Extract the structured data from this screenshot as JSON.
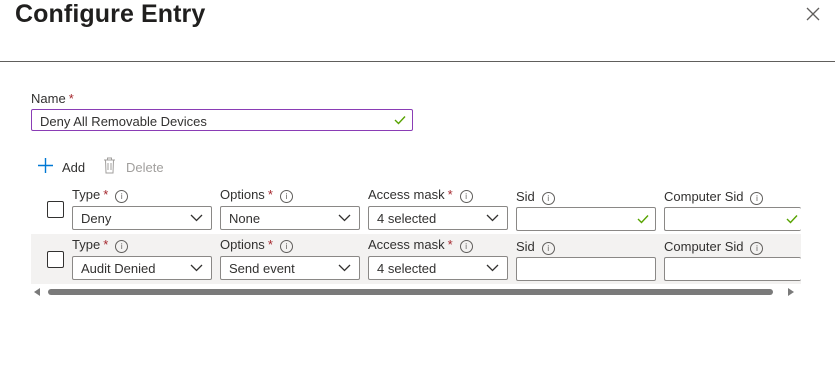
{
  "panel": {
    "title": "Configure Entry",
    "close_icon": "close-icon"
  },
  "name_field": {
    "label": "Name",
    "required_mark": "*",
    "value": "Deny All Removable Devices",
    "valid": true
  },
  "toolbar": {
    "add_label": "Add",
    "delete_label": "Delete",
    "add_icon": "plus-icon",
    "delete_icon": "trash-icon"
  },
  "columns": {
    "type": "Type",
    "options": "Options",
    "access_mask": "Access mask",
    "sid": "Sid",
    "computer_sid": "Computer Sid",
    "required_mark": "*",
    "info_glyph": "i"
  },
  "rows": [
    {
      "type": "Deny",
      "options": "None",
      "access_mask": "4 selected",
      "sid": "",
      "computer_sid": "",
      "checked": false
    },
    {
      "type": "Audit Denied",
      "options": "Send event",
      "access_mask": "4 selected",
      "sid": "",
      "computer_sid": "",
      "checked": false
    }
  ],
  "colors": {
    "focus_border": "#8a3db5",
    "required": "#a4262c",
    "accent": "#0078d4",
    "valid_check": "#57a300",
    "row_alt_bg": "#f3f2f1"
  }
}
